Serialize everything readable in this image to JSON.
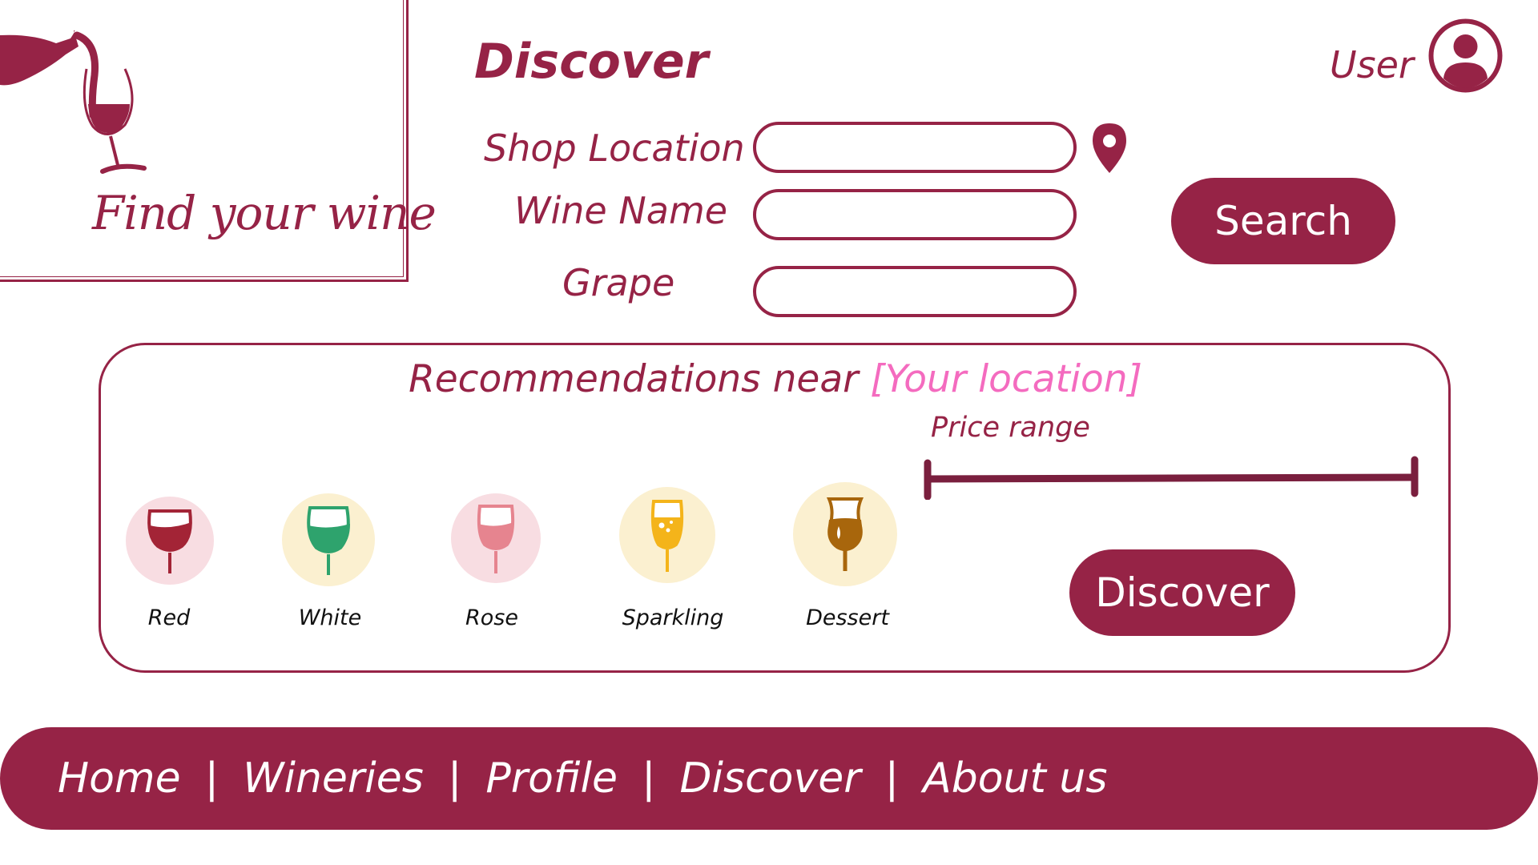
{
  "colors": {
    "brand": "#962346",
    "accent_pink": "#f46bbf",
    "white": "#ffffff"
  },
  "logo": {
    "tagline": "Find your wine",
    "icon": "wine-pour-icon"
  },
  "header": {
    "title": "Discover",
    "user_label": "User",
    "avatar_icon": "user-avatar-icon"
  },
  "search_form": {
    "fields": [
      {
        "label": "Shop Location",
        "value": "",
        "placeholder": ""
      },
      {
        "label": "Wine Name",
        "value": "",
        "placeholder": ""
      },
      {
        "label": "Grape",
        "value": "",
        "placeholder": ""
      }
    ],
    "location_icon": "map-pin-icon",
    "search_button": "Search"
  },
  "recommendations": {
    "title_prefix": "Recommendations near ",
    "location_placeholder": "[Your location]",
    "price_range_label": "Price range",
    "discover_button": "Discover",
    "wine_types": [
      {
        "label": "Red",
        "icon": "red-wine-glass-icon",
        "bg": "#f8dde2",
        "fill": "#a32436"
      },
      {
        "label": "White",
        "icon": "white-wine-glass-icon",
        "bg": "#fbf0d0",
        "fill": "#2ea36d"
      },
      {
        "label": "Rose",
        "icon": "rose-wine-glass-icon",
        "bg": "#f8dde2",
        "fill": "#e6848f"
      },
      {
        "label": "Sparkling",
        "icon": "sparkling-wine-glass-icon",
        "bg": "#fbf0d0",
        "fill": "#f4b41a"
      },
      {
        "label": "Dessert",
        "icon": "dessert-wine-glass-icon",
        "bg": "#fbf0d0",
        "fill": "#a8660c"
      }
    ]
  },
  "footer_nav": {
    "items": [
      "Home",
      "Wineries",
      "Profile",
      "Discover",
      "About us"
    ],
    "separator": "|"
  }
}
